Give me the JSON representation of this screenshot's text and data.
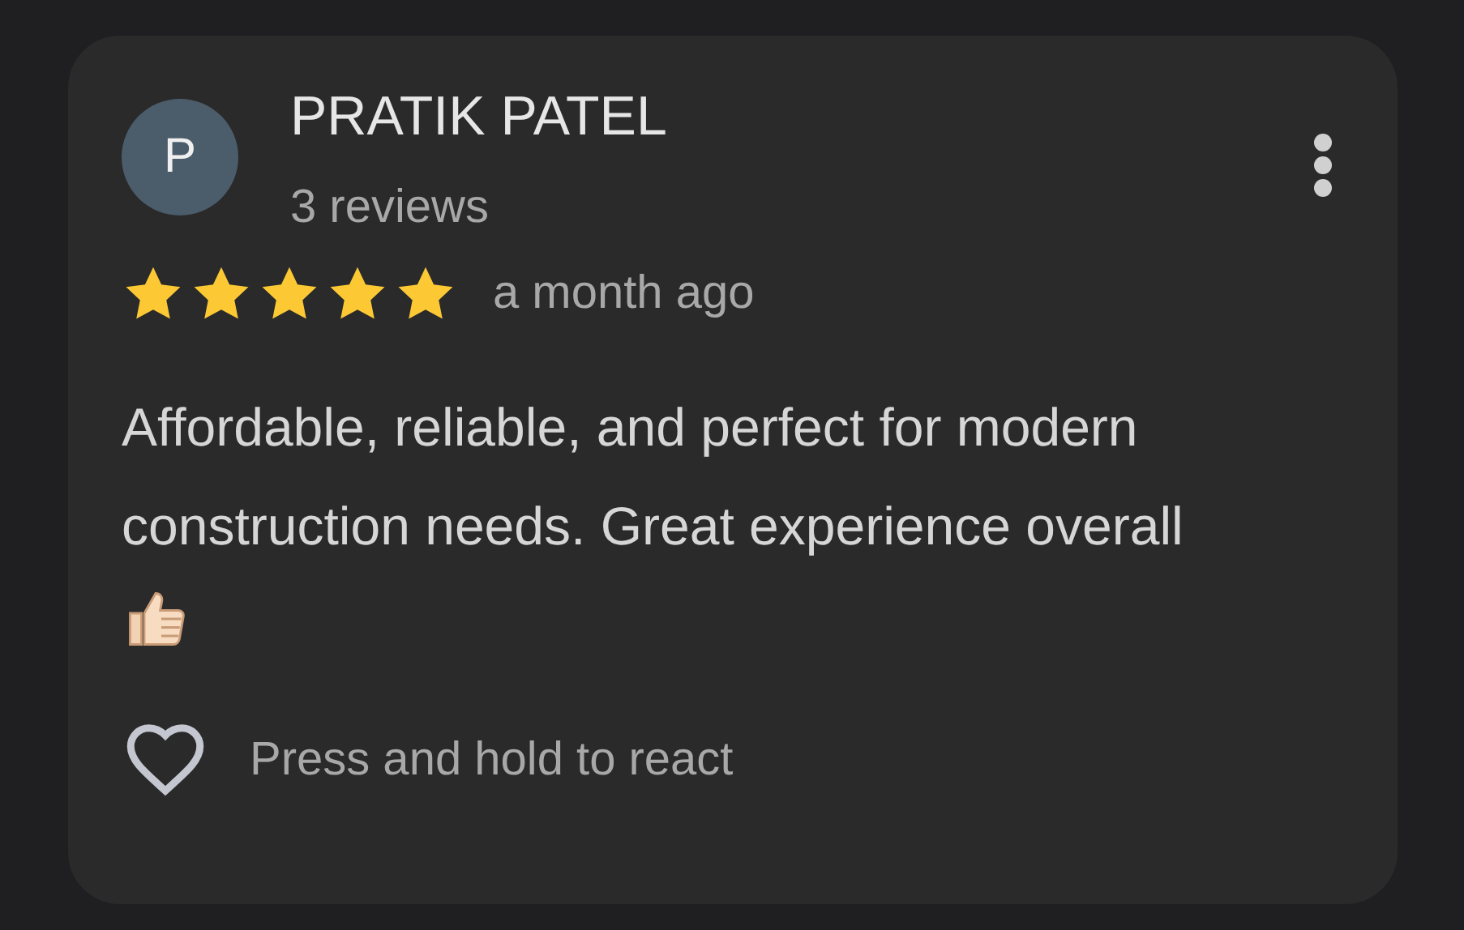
{
  "review": {
    "avatar_letter": "P",
    "author": "PRATIK PATEL",
    "reviews_count": "3 reviews",
    "stars": 5,
    "time": "a month ago",
    "text": "Affordable, reliable, and perfect for modern construction needs. Great experience overall",
    "react_hint": "Press and hold to react"
  }
}
